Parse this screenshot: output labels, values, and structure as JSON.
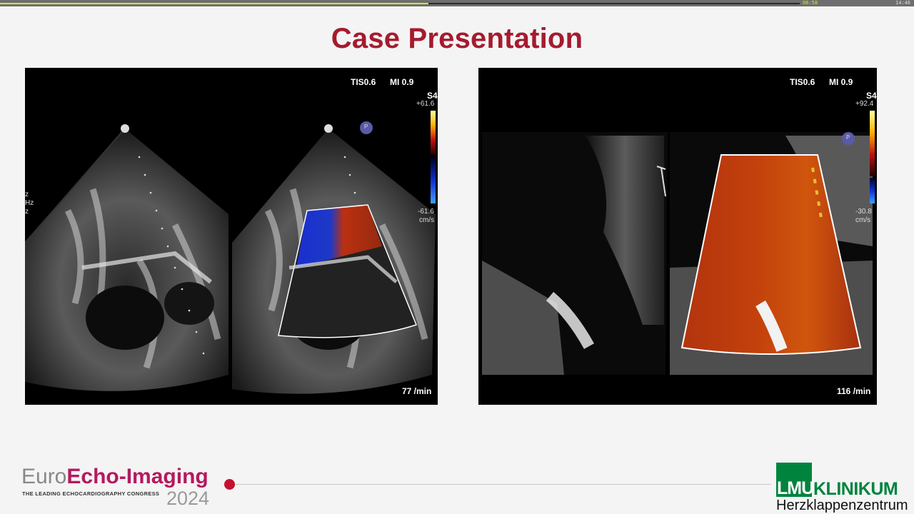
{
  "player": {
    "elapsed": "06:58",
    "total": "14:46",
    "progress": 0.47,
    "colors": {
      "played": "#d8e23a",
      "track": "#6e6e6e"
    }
  },
  "slide": {
    "title": "Case Presentation",
    "title_color": "#a51b2e"
  },
  "echo_left": {
    "tis": "TIS0.6",
    "mi": "MI 0.9",
    "probe": "S4",
    "scale_top": "+61.6",
    "scale_bottom": "-61.6",
    "unit": "cm/s",
    "heart_rate": "77 /min",
    "side_a": "z",
    "side_b": "Hz",
    "side_c": "z",
    "marker": "P"
  },
  "echo_right": {
    "tis": "TIS0.6",
    "mi": "MI 0.9",
    "probe": "S4",
    "scale_top": "+92.4",
    "scale_bottom": "-30.8",
    "unit": "cm/s",
    "heart_rate": "116 /min",
    "marker": "P"
  },
  "footer": {
    "congress_euro": "Euro",
    "congress_name": "Echo-Imaging",
    "congress_tagline": "THE LEADING ECHOCARDIOGRAPHY CONGRESS",
    "congress_year": "2024",
    "lmu": "LMU",
    "klinikum": "KLINIKUM",
    "department": "Herzklappenzentrum",
    "colors": {
      "congress": "#b5195f",
      "lmu_green": "#00843d",
      "dot": "#c6102e"
    }
  }
}
